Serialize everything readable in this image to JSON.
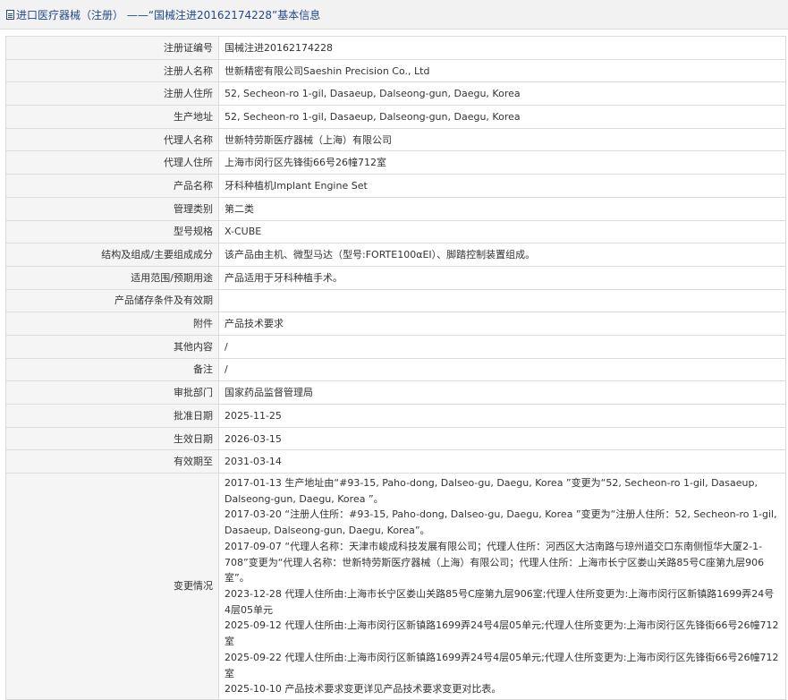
{
  "header": {
    "title": "进口医疗器械（注册） ——“国械注进20162174228”基本信息",
    "icon": "document-icon",
    "title_color": "#1f4a8a"
  },
  "rows": [
    {
      "name": "registration-number",
      "label": "注册证编号",
      "value": "国械注进20162174228"
    },
    {
      "name": "registrant-name",
      "label": "注册人名称",
      "value": "世新精密有限公司Saeshin Precision Co., Ltd"
    },
    {
      "name": "registrant-address",
      "label": "注册人住所",
      "value": "52, Secheon-ro 1-gil, Dasaeup, Dalseong-gun, Daegu, Korea"
    },
    {
      "name": "production-address",
      "label": "生产地址",
      "value": "52, Secheon-ro 1-gil, Dasaeup, Dalseong-gun, Daegu, Korea"
    },
    {
      "name": "agent-name",
      "label": "代理人名称",
      "value": "世新特劳斯医疗器械（上海）有限公司"
    },
    {
      "name": "agent-address",
      "label": "代理人住所",
      "value": "上海市闵行区先锋街66号26幢712室"
    },
    {
      "name": "product-name",
      "label": "产品名称",
      "value": "牙科种植机Implant Engine Set"
    },
    {
      "name": "management-category",
      "label": "管理类别",
      "value": "第二类"
    },
    {
      "name": "model-spec",
      "label": "型号规格",
      "value": "X-CUBE"
    },
    {
      "name": "structure-composition",
      "label": "结构及组成/主要组成成分",
      "value": "该产品由主机、微型马达（型号:FORTE100αEI）、脚踏控制装置组成。"
    },
    {
      "name": "intended-use",
      "label": "适用范围/预期用途",
      "value": "产品适用于牙科种植手术。"
    },
    {
      "name": "storage-conditions",
      "label": "产品储存条件及有效期",
      "value": ""
    },
    {
      "name": "attachment",
      "label": "附件",
      "value": "产品技术要求"
    },
    {
      "name": "other-content",
      "label": "其他内容",
      "value": "/"
    },
    {
      "name": "remarks",
      "label": "备注",
      "value": "/"
    },
    {
      "name": "approval-department",
      "label": "审批部门",
      "value": "国家药品监督管理局"
    },
    {
      "name": "approval-date",
      "label": "批准日期",
      "value": "2025-11-25"
    },
    {
      "name": "effective-date",
      "label": "生效日期",
      "value": "2026-03-15"
    },
    {
      "name": "expiry-date",
      "label": "有效期至",
      "value": "2031-03-14"
    }
  ],
  "changes": {
    "label": "变更情况",
    "entries": [
      "2017-01-13 生产地址由“#93-15, Paho-dong, Dalseo-gu, Daegu, Korea ”变更为“52, Secheon-ro 1-gil, Dasaeup, Dalseong-gun, Daegu, Korea ”。",
      "2017-03-20 “注册人住所：#93-15, Paho-dong, Dalseo-gu, Daegu, Korea ”变更为“注册人住所：52, Secheon-ro 1-gil, Dasaeup, Dalseong-gun, Daegu, Korea”。",
      "2017-09-07 “代理人名称：天津市峻成科技发展有限公司；代理人住所：河西区大沽南路与琼州道交口东南侧恒华大厦2-1-708”变更为“代理人名称：世新特劳斯医疗器械（上海）有限公司；代理人住所：上海市长宁区娄山关路85号C座第九层906室”。",
      "2023-12-28 代理人住所由:上海市长宁区娄山关路85号C座第九层906室;代理人住所变更为:上海市闵行区新镇路1699弄24号4层05单元",
      "2025-09-12 代理人住所由:上海市闵行区新镇路1699弄24号4层05单元;代理人住所变更为:上海市闵行区先锋街66号26幢712室",
      "2025-09-22 代理人住所由:上海市闵行区新镇路1699弄24号4层05单元;代理人住所变更为:上海市闵行区先锋街66号26幢712室",
      "2025-10-10 产品技术要求变更详见产品技术要求变更对比表。"
    ]
  }
}
